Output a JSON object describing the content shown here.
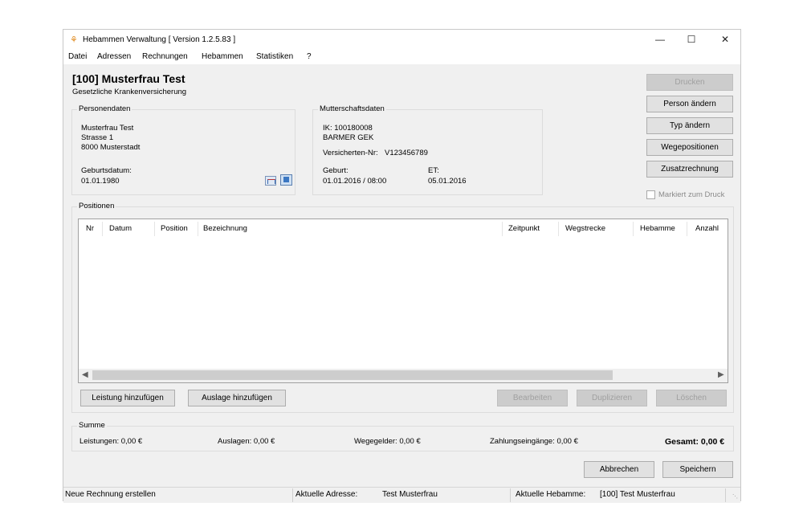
{
  "window": {
    "title": "Hebammen Verwaltung [ Version 1.2.5.83 ]",
    "controls": {
      "minimize": "—",
      "maximize": "☐",
      "close": "✕"
    }
  },
  "menu": [
    "Datei",
    "Adressen",
    "Rechnungen",
    "Hebammen",
    "Statistiken",
    "?"
  ],
  "header": {
    "name": "[100] Musterfrau Test",
    "insurance": "Gesetzliche Krankenversicherung"
  },
  "personendaten": {
    "title": "Personendaten",
    "name": "Musterfrau Test",
    "street": "Strasse 1",
    "city": "8000 Musterstadt",
    "birth_label": "Geburtsdatum:",
    "birth_value": "01.01.1980"
  },
  "mutterschaft": {
    "title": "Mutterschaftsdaten",
    "ik": "IK: 100180008",
    "kasse": "BARMER GEK",
    "versicherten_label": "Versicherten-Nr:",
    "versicherten_value": "V123456789",
    "geburt_label": "Geburt:",
    "geburt_value": "01.01.2016 / 08:00",
    "et_label": "ET:",
    "et_value": "05.01.2016"
  },
  "side_buttons": {
    "drucken": "Drucken",
    "person_aendern": "Person ändern",
    "typ_aendern": "Typ ändern",
    "wegepositionen": "Wegepositionen",
    "zusatzrechnung": "Zusatzrechnung",
    "markiert": "Markiert zum Druck"
  },
  "positionen": {
    "title": "Positionen",
    "columns": [
      "Nr",
      "Datum",
      "Position",
      "Bezeichnung",
      "Zeitpunkt",
      "Wegstrecke",
      "Hebamme",
      "Anzahl"
    ],
    "rows": []
  },
  "action_buttons": {
    "leistung": "Leistung hinzufügen",
    "auslage": "Auslage hinzufügen",
    "bearbeiten": "Bearbeiten",
    "duplizieren": "Duplizieren",
    "loeschen": "Löschen"
  },
  "summe": {
    "title": "Summe",
    "leistungen": "Leistungen: 0,00 €",
    "auslagen": "Auslagen: 0,00 €",
    "wegegelder": "Wegegelder: 0,00 €",
    "zahlungseingaenge": "Zahlungseingänge: 0,00 €",
    "gesamt": "Gesamt: 0,00 €"
  },
  "footer_buttons": {
    "abbrechen": "Abbrechen",
    "speichern": "Speichern"
  },
  "status": {
    "message": "Neue Rechnung erstellen",
    "adresse_label": "Aktuelle Adresse:",
    "adresse_value": "Test Musterfrau",
    "hebamme_label": "Aktuelle Hebamme:",
    "hebamme_value": "[100] Test Musterfrau"
  }
}
